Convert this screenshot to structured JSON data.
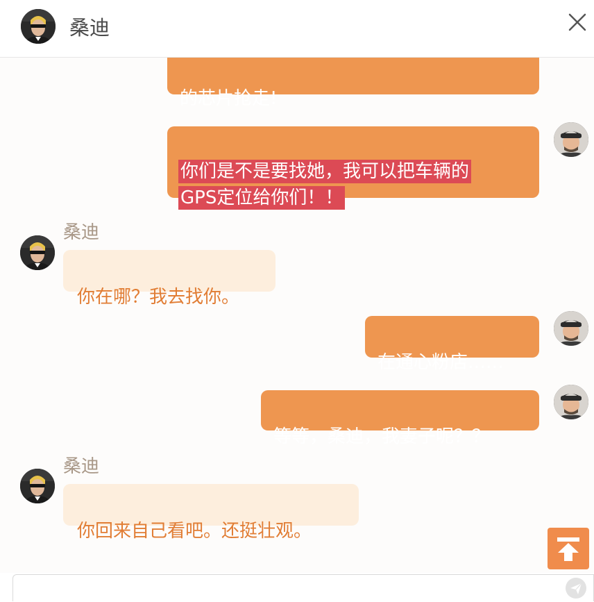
{
  "header": {
    "contact_name": "桑迪",
    "close_icon": "close-icon"
  },
  "messages": [
    {
      "from": "me",
      "text": "的芯片抢走!"
    },
    {
      "from": "me",
      "text": "你们是不是要找她，我可以把车辆的\nGPS定位给你们！！",
      "highlighted": true
    },
    {
      "from": "sandy",
      "sender": "桑迪",
      "text": "你在哪？我去找你。"
    },
    {
      "from": "me",
      "text": "在通心粉店……"
    },
    {
      "from": "me",
      "text": "等等，桑迪，我妻子呢？？"
    },
    {
      "from": "sandy",
      "sender": "桑迪",
      "text": "你回来自己看吧。还挺壮观。"
    }
  ],
  "controls": {
    "scroll_top_icon": "arrow-up-to-top-icon",
    "send_icon": "send-icon",
    "input_value": ""
  },
  "colors": {
    "outgoing_bubble": "#ee9650",
    "incoming_bubble": "#fdeedd",
    "incoming_text": "#e17d34",
    "highlight": "#dc4a55",
    "accent": "#f08c4c"
  }
}
